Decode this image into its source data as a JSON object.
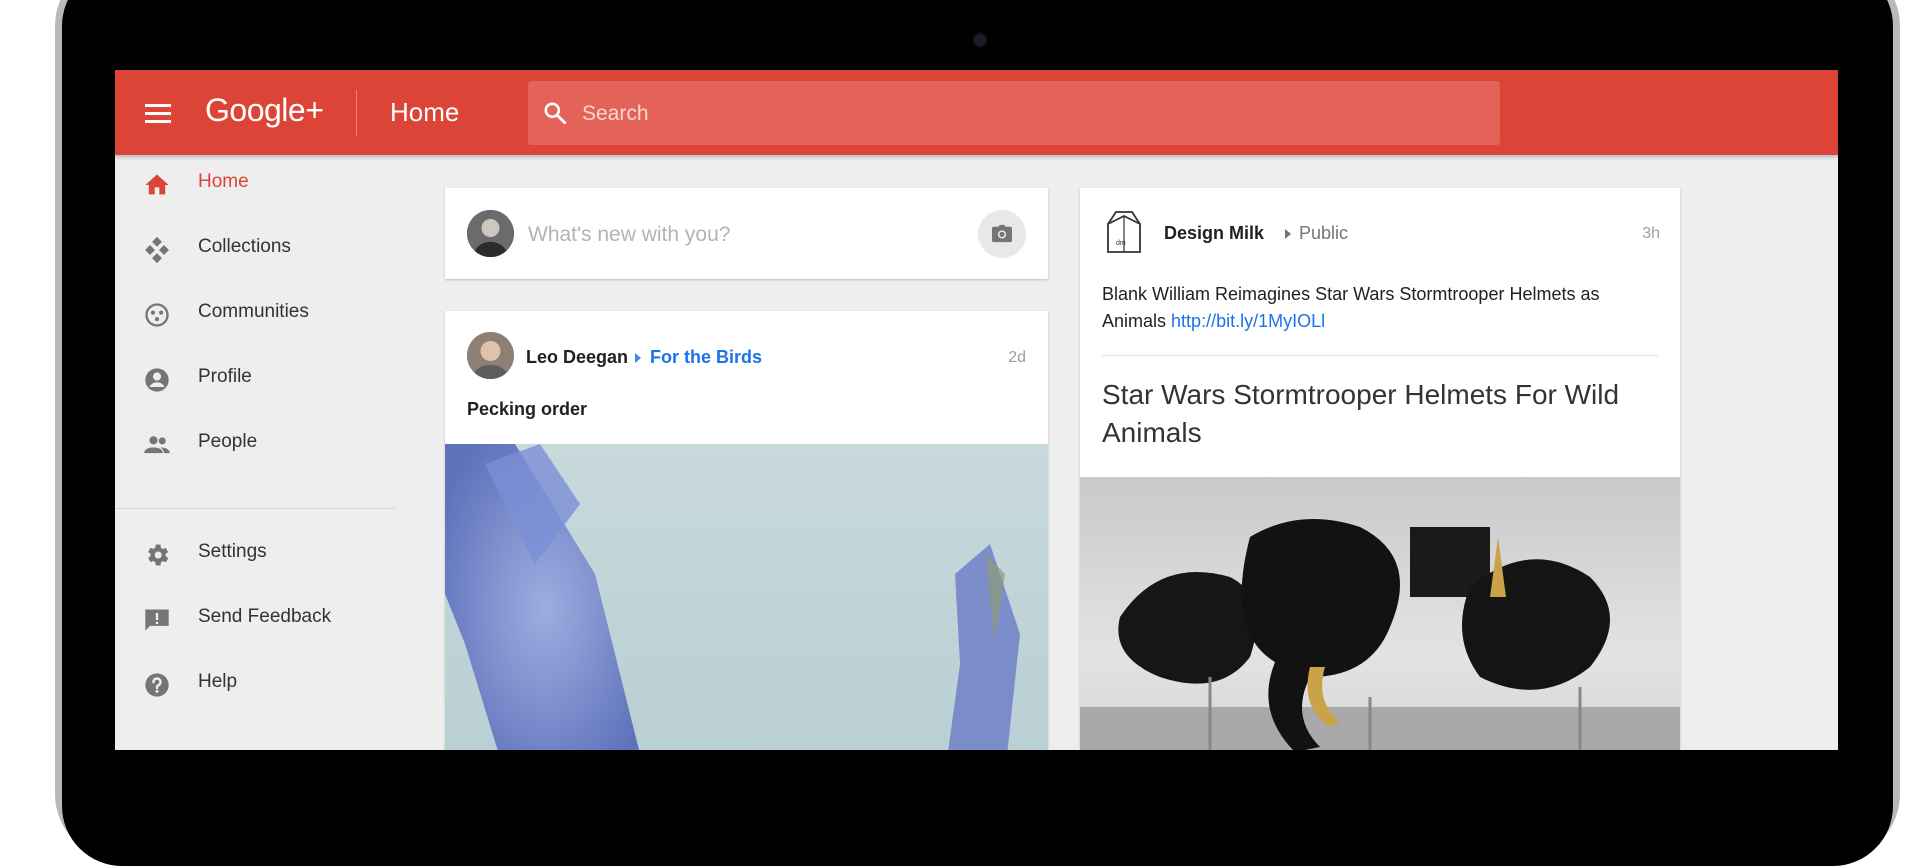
{
  "app": {
    "logo": "Google+",
    "page_title": "Home"
  },
  "search": {
    "placeholder": "Search"
  },
  "sidebar": {
    "items": [
      {
        "label": "Home",
        "icon": "home-icon",
        "active": true
      },
      {
        "label": "Collections",
        "icon": "collections-icon"
      },
      {
        "label": "Communities",
        "icon": "communities-icon"
      },
      {
        "label": "Profile",
        "icon": "profile-icon"
      },
      {
        "label": "People",
        "icon": "people-icon"
      },
      {
        "label": "Settings",
        "icon": "gear-icon"
      },
      {
        "label": "Send Feedback",
        "icon": "feedback-icon"
      },
      {
        "label": "Help",
        "icon": "help-icon"
      }
    ]
  },
  "composer": {
    "placeholder": "What's new with you?",
    "camera_icon": "camera-icon"
  },
  "posts": [
    {
      "author": "Leo Deegan",
      "community": "For the Birds",
      "time": "2d",
      "text": "Pecking order"
    },
    {
      "author": "Design Milk",
      "visibility": "Public",
      "time": "3h",
      "text": "Blank William Reimagines Star Wars Stormtrooper Helmets as Animals",
      "link": "http://bit.ly/1MyIOLl",
      "link_title": "Star Wars Stormtrooper Helmets For Wild Animals"
    }
  ],
  "colors": {
    "brand_red": "#db4437",
    "link_blue": "#1a73e8",
    "background": "#eeeeee"
  }
}
